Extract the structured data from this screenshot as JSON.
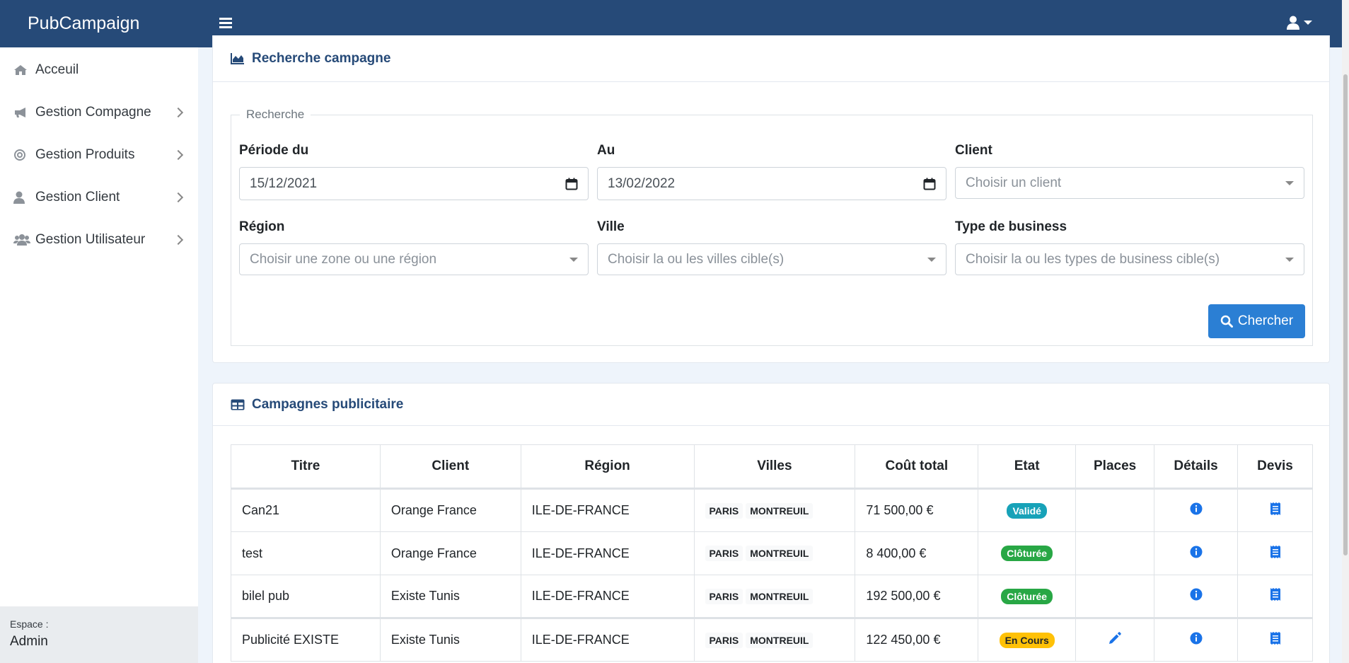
{
  "app": {
    "brand": "PubCampaign"
  },
  "sidebar": {
    "items": [
      {
        "label": "Acceuil",
        "icon": "home-icon"
      },
      {
        "label": "Gestion Compagne",
        "icon": "bullhorn-icon"
      },
      {
        "label": "Gestion Produits",
        "icon": "bullseye-icon"
      },
      {
        "label": "Gestion Client",
        "icon": "user-icon"
      },
      {
        "label": "Gestion Utilisateur",
        "icon": "users-icon"
      }
    ],
    "footer": {
      "label": "Espace :",
      "value": "Admin"
    }
  },
  "search_card": {
    "title": "Recherche campagne",
    "legend": "Recherche",
    "period_from": {
      "label": "Période du",
      "value": "15/12/2021"
    },
    "period_to": {
      "label": "Au",
      "value": "13/02/2022"
    },
    "client": {
      "label": "Client",
      "placeholder": "Choisir un client"
    },
    "region": {
      "label": "Région",
      "placeholder": "Choisir une zone ou une région"
    },
    "city": {
      "label": "Ville",
      "placeholder": "Choisir la ou les villes cible(s)"
    },
    "business": {
      "label": "Type de business",
      "placeholder": "Choisir la ou les types de business cible(s)"
    },
    "search_button": "Chercher"
  },
  "campaigns_card": {
    "title": "Campagnes publicitaire",
    "columns": [
      "Titre",
      "Client",
      "Région",
      "Villes",
      "Coût total",
      "Etat",
      "Places",
      "Détails",
      "Devis"
    ],
    "rows": [
      {
        "title": "Can21",
        "client": "Orange France",
        "region": "ILE-DE-FRANCE",
        "cities": [
          "PARIS",
          "MONTREUIL"
        ],
        "cost": "71 500,00 €",
        "state": "Validé",
        "state_color": "#17a2b8",
        "editable": false
      },
      {
        "title": "test",
        "client": "Orange France",
        "region": "ILE-DE-FRANCE",
        "cities": [
          "PARIS",
          "MONTREUIL"
        ],
        "cost": "8 400,00 €",
        "state": "Clôturée",
        "state_color": "#28a745",
        "editable": false
      },
      {
        "title": "bilel pub",
        "client": "Existe Tunis",
        "region": "ILE-DE-FRANCE",
        "cities": [
          "PARIS",
          "MONTREUIL"
        ],
        "cost": "192 500,00 €",
        "state": "Clôturée",
        "state_color": "#28a745",
        "editable": false
      },
      {
        "title": "Publicité EXISTE",
        "client": "Existe Tunis",
        "region": "ILE-DE-FRANCE",
        "cities": [
          "PARIS",
          "MONTREUIL"
        ],
        "cost": "122 450,00 €",
        "state": "En Cours",
        "state_color": "#ffc107",
        "editable": true
      }
    ]
  },
  "colors": {
    "topbar": "#264a78",
    "accent": "#2b7fd4",
    "info": "#17a2b8",
    "success": "#28a745",
    "warning": "#ffc107"
  }
}
